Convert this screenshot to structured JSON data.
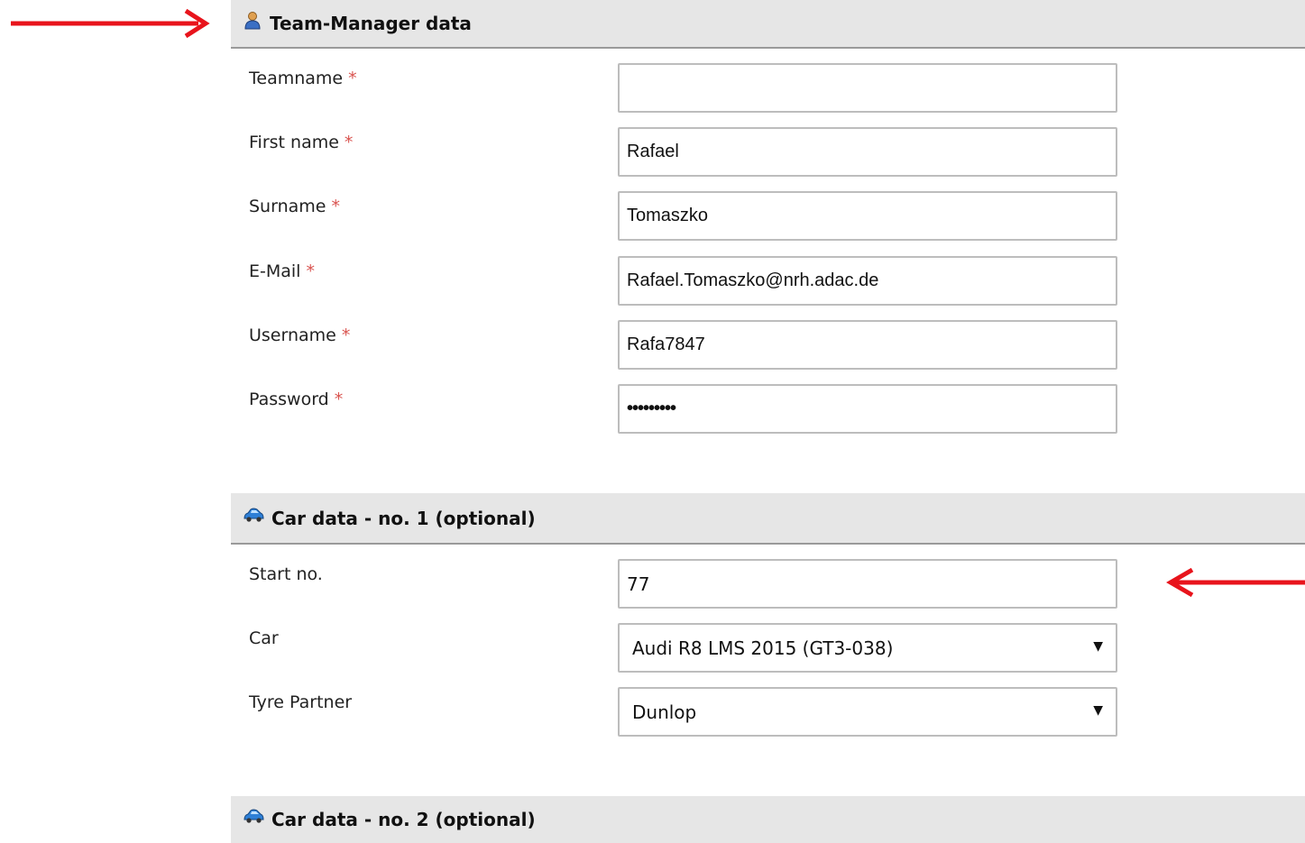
{
  "team_manager": {
    "title": "Team-Manager data",
    "icon": "user-icon",
    "fields": [
      {
        "label": "Teamname",
        "required_mark": "*",
        "value": "",
        "type": "text"
      },
      {
        "label": "First name",
        "required_mark": "*",
        "value": "Rafael",
        "type": "text"
      },
      {
        "label": "Surname",
        "required_mark": "*",
        "value": "Tomaszko",
        "type": "text"
      },
      {
        "label": "E-Mail",
        "required_mark": "*",
        "value": "Rafael.Tomaszko@nrh.adac.de",
        "type": "text"
      },
      {
        "label": "Username",
        "required_mark": "*",
        "value": "Rafa7847",
        "type": "text"
      },
      {
        "label": "Password",
        "required_mark": "*",
        "value": "•••••••••",
        "type": "password"
      }
    ]
  },
  "car1": {
    "title": "Car data - no. 1 (optional)",
    "icon": "car-icon",
    "start_no_label": "Start no.",
    "start_no_value": "77",
    "car_label": "Car",
    "car_value": "Audi R8 LMS 2015 (GT3-038)",
    "tyre_label": "Tyre Partner",
    "tyre_value": "Dunlop",
    "caret": "▼"
  },
  "car2": {
    "title": "Car data - no. 2 (optional)",
    "icon": "car-icon"
  },
  "colors": {
    "header_bg": "#e6e6e6",
    "required": "#d9534f",
    "annotation_arrow": "#e8141c"
  }
}
